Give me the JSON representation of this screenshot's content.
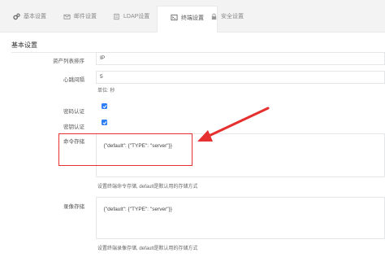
{
  "tabs": [
    {
      "label": "基本设置",
      "icon": "gears-icon",
      "active": false
    },
    {
      "label": "邮件设置",
      "icon": "envelope-icon",
      "active": false
    },
    {
      "label": "LDAP设置",
      "icon": "server-icon",
      "active": false
    },
    {
      "label": "终端设置",
      "icon": "terminal-icon",
      "active": true
    },
    {
      "label": "安全设置",
      "icon": "lock-icon",
      "active": false
    }
  ],
  "section": {
    "title": "基本设置"
  },
  "form": {
    "asset_sort": {
      "label": "资产列表排序",
      "value": "IP"
    },
    "heartbeat": {
      "label": "心跳间隔",
      "value": "5",
      "help": "单位: 秒"
    },
    "password_auth": {
      "label": "密码认证",
      "checked": true
    },
    "key_auth": {
      "label": "密钥认证",
      "checked": true
    },
    "command_storage": {
      "label": "命令存储",
      "value": "{\"default\": {\"TYPE\": \"server\"}}",
      "help": "设置终端命令存储, default是默认用的存储方式"
    },
    "replay_storage": {
      "label": "录像存储",
      "value": "{\"default\": {\"TYPE\": \"server\"}}",
      "help": "设置终端录像存储, default是默认用的存储方式"
    }
  },
  "colors": {
    "highlight": "#e5302f",
    "checkbox": "#2d7ff9"
  }
}
